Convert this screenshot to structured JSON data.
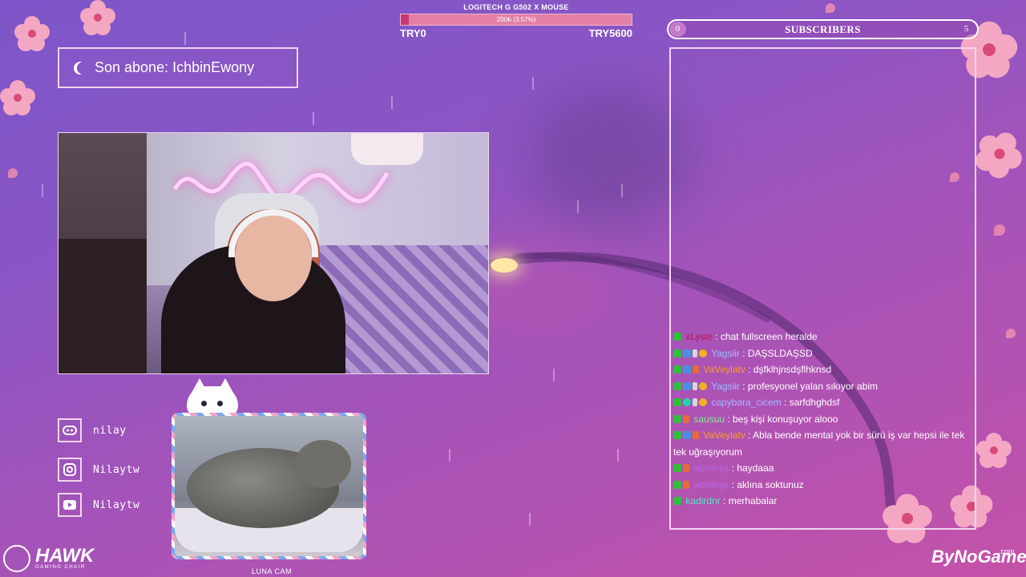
{
  "goal": {
    "title": "LOGITECH G G502 X MOUSE",
    "progress_text": "200₺ (3.57%)",
    "progress_fraction": 0.0357,
    "min": "TRY0",
    "max": "TRY5600"
  },
  "subscribers": {
    "label": "SUBSCRIBERS",
    "min": "0",
    "max": "5"
  },
  "last_sub": {
    "text": "Son abone: IchbinEwony"
  },
  "socials": [
    {
      "icon": "discord-icon",
      "label": "nilay"
    },
    {
      "icon": "instagram-icon",
      "label": "Nilaytw"
    },
    {
      "icon": "youtube-icon",
      "label": "Nilaytw"
    }
  ],
  "cat_cam": {
    "label": "LUNA CAM"
  },
  "chat": [
    {
      "user": "xLysie",
      "color": "#c0144a",
      "text": ": chat fullscreen heralde"
    },
    {
      "user": "Yagsiir",
      "color": "#8fc4ff",
      "text": ": DAŞSLDAŞSD"
    },
    {
      "user": "VaVeylatv",
      "color": "#ff9f1c",
      "text": ": dşfklhjnsdşflhknsd"
    },
    {
      "user": "Yagsiir",
      "color": "#8fc4ff",
      "text": ": profesyonel yalan sıkıyor abim"
    },
    {
      "user": "capybara_cicem",
      "color": "#a7b4ff",
      "text": ": sarfdhghdsf"
    },
    {
      "user": "sausuu",
      "color": "#7bf28a",
      "text": ": beş kişi konuşuyor alooo"
    },
    {
      "user": "VaVeylatv",
      "color": "#ff9f1c",
      "text": ": Abla bende mental yok bir sürü iş var hepsi ile tek tek uğraşıyorum"
    },
    {
      "user": "womnys",
      "color": "#b46be8",
      "text": ": haydaaa"
    },
    {
      "user": "womnys",
      "color": "#b46be8",
      "text": ": aklına soktunuz"
    },
    {
      "user": "kadirdnr",
      "color": "#57e6c8",
      "text": ": merhabalar"
    }
  ],
  "brands": {
    "hawk": "HAWK",
    "hawk_sub": "GAMING CHAIR",
    "bynogame": "ByNoGame",
    "bynogame_suffix": ".com"
  }
}
